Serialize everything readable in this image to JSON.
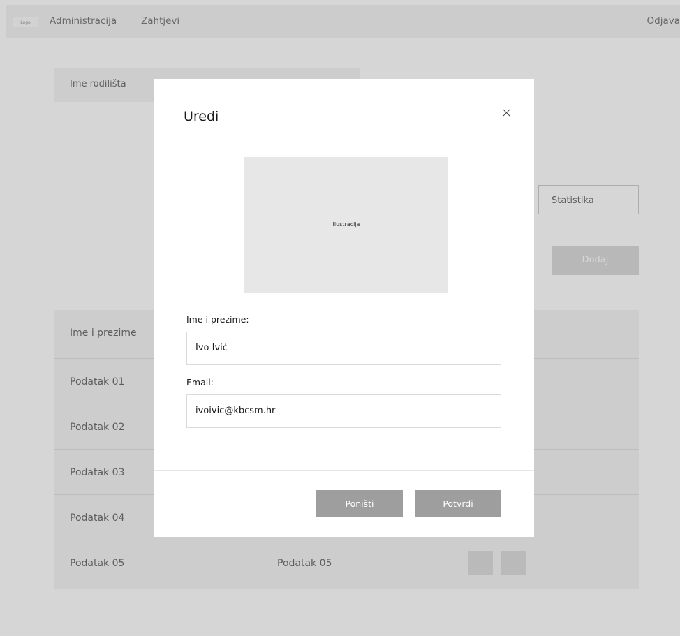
{
  "nav": {
    "logo": "Logo",
    "links": [
      "Administracija",
      "Zahtjevi"
    ],
    "logout": "Odjava"
  },
  "background": {
    "name_box_label": "Ime rodilišta",
    "tab_statistika": "Statistika",
    "add_button": "Dodaj",
    "table": {
      "header": "Ime i prezime",
      "rows": [
        {
          "col1": "Podatak 01",
          "col2": ""
        },
        {
          "col1": "Podatak 02",
          "col2": ""
        },
        {
          "col1": "Podatak 03",
          "col2": ""
        },
        {
          "col1": "Podatak 04",
          "col2": ""
        },
        {
          "col1": "Podatak 05",
          "col2": "Podatak 05"
        }
      ]
    }
  },
  "modal": {
    "title": "Uredi",
    "close_icon": "close-icon",
    "illustration_label": "Ilustracija",
    "name_label": "Ime i prezime:",
    "name_value": "Ivo Ivić",
    "email_label": "Email:",
    "email_value": "ivoivic@kbcsm.hr",
    "cancel_label": "Poništi",
    "confirm_label": "Potvrdi"
  },
  "colors": {
    "overlay": "#00000029",
    "button": "#9e9e9e",
    "surface": "#f5f5f5"
  }
}
